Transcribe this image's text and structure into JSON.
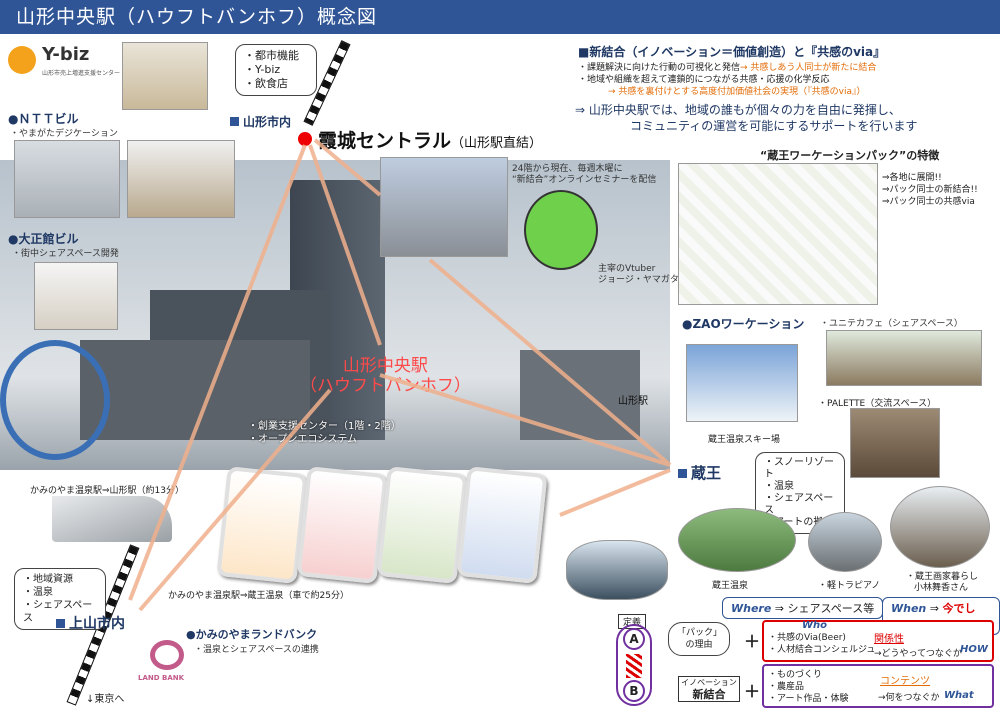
{
  "title": "山形中央駅（ハウフトバンホフ）概念図",
  "logo": {
    "name": "Y-biz",
    "sub": "山形市売上増進支援センター"
  },
  "top_bubble": [
    "・都市機能",
    "・Y-biz",
    "・飲食店"
  ],
  "yamagata_shinai": "山形市内",
  "ntt": {
    "label": "ＮＴＴビル",
    "sub": "・やまがたデジケーション"
  },
  "taisho": {
    "label": "大正館ビル",
    "sub": "・街中シェアスペース開発"
  },
  "kasumi": {
    "label": "霞城セントラル",
    "paren": "（山形駅直結）"
  },
  "seminar_note": [
    "24階から現在、毎週木曜に",
    "“新結合”オンラインセミナーを配信"
  ],
  "vtuber_caption": [
    "主宰のVtuber",
    "ジョージ・ヤマガタ氏"
  ],
  "center_label": [
    "山形中央駅",
    "（ハウフトバンホフ）"
  ],
  "yamagata_station": "山形駅",
  "sogyo": [
    "・創業支援センター（1階・2階）",
    "・オープンエコシステム"
  ],
  "concept": {
    "heading": "新結合（イノベーション＝価値創造）と『共感のvia』",
    "lines": [
      "・課題解決に向けた行動の可視化と発信",
      "→ 共感しあう人同士が新たに結合",
      "・地域や組織を超えて連鎖的につながる共感・応援の化学反応",
      "→ 共感を裏付けとする高度付加価値社会の実現（『共感のvia』）"
    ],
    "summary": [
      "⇒ 山形中央駅では、地域の誰もが個々の力を自由に発揮し、",
      "コミュニティの運営を可能にするサポートを行います"
    ]
  },
  "zao_pack": {
    "title": "“蔵王ワーケーションパック”の特徴",
    "points": [
      "⇒各地に展開!!",
      "⇒パック同士の新結合!!",
      "⇒パック同士の共感via"
    ]
  },
  "zao_workation": "ZAOワーケーション",
  "unite_cafe": "・ユニテカフェ（シェアスペース）",
  "palette": "PALETTE（交流スペース）",
  "zao_ski": "蔵王温泉スキー場",
  "zao": "蔵王",
  "zao_bubble": [
    "・スノーリゾート",
    "・温泉",
    "・シェアスペース",
    "・アートの拠点"
  ],
  "zao_onsen": "蔵王温泉",
  "kei_piano": "・軽トラピアノ",
  "zao_painter": [
    "・蔵王画家暮らし",
    "小林舞香さん"
  ],
  "where": {
    "k": "Where",
    "v": "シェアスペース等"
  },
  "when": {
    "k": "When",
    "v": "今でしょ!!"
  },
  "kaminoyama_route": "かみのやま温泉駅⇒山形駅（約13分）",
  "kaminoyama_route2": "かみのやま温泉駅⇒蔵王温泉（車で約25分）",
  "kami_bubble": [
    "・地域資源",
    "・温泉",
    "・シェアスペース"
  ],
  "kaminoyama_shinai": "上山市内",
  "landbank": {
    "label": "かみのやまランドバンク",
    "sub": "・温泉とシェアスペースの連携",
    "logo": "LAND BANK"
  },
  "tokyo": "東京へ",
  "teigi": "定義",
  "circle_a": "A",
  "circle_b": "B",
  "pack_reason": [
    "「パック」",
    "の理由"
  ],
  "innovation": [
    "イノベーション",
    "新結合"
  ],
  "who_box": {
    "label": "Who",
    "items": [
      "・共感のVia(Beer)",
      "・人材結合コンシェルジュ"
    ],
    "kw": "関係性",
    "q": "→どうやってつなぐか",
    "tag": "HOW"
  },
  "what_box": {
    "items": [
      "・ものづくり",
      "・農産品",
      "・アート作品・体験"
    ],
    "kw": "コンテンツ",
    "q": "→何をつなぐか",
    "tag": "What"
  },
  "colors": {
    "navy": "#2f5597",
    "orange": "#e36c09",
    "red": "#d00000",
    "purple": "#7030a0"
  }
}
